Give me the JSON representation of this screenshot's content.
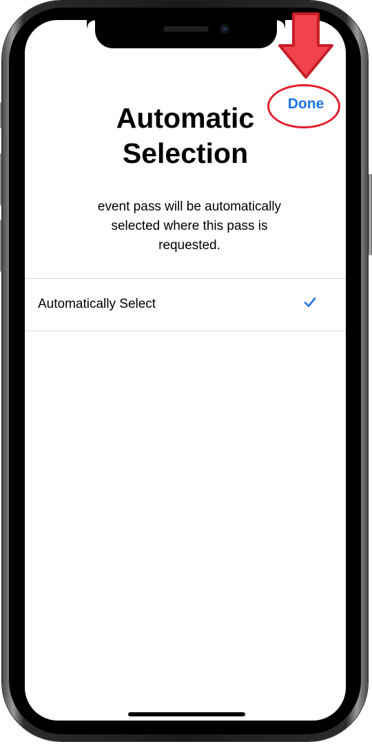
{
  "header": {
    "done_label": "Done"
  },
  "title": {
    "line1": "Automatic",
    "line2": "Selection"
  },
  "description": "event pass will be  automatically\nselected where this pass is\nrequested.",
  "options": [
    {
      "label": "Automatically Select",
      "selected": true
    }
  ],
  "icons": {
    "check": "checkmark-icon"
  },
  "colors": {
    "accent": "#1a73e8",
    "annotation": "#e41e2b",
    "divider": "#d9d9d9"
  }
}
